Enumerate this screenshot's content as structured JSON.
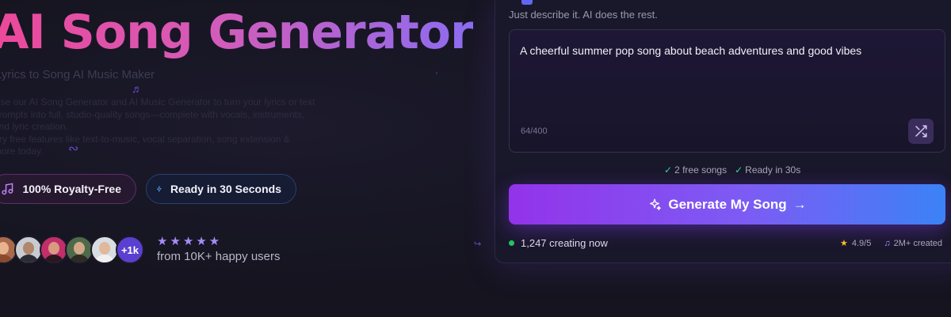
{
  "hero": {
    "title": "AI Song Generator",
    "subtitle": "Lyrics to Song AI Music Maker",
    "description_lines": [
      "Use our AI Song Generator and AI Music Generator to turn your lyrics or text",
      "prompts into full, studio-quality songs—complete with vocals, instruments,",
      "and lyric creation.",
      "Try free features like text-to-music, vocal separation, song extension &",
      "more today."
    ],
    "badges": {
      "royalty_free": "100% Royalty-Free",
      "ready_time": "Ready in 30 Seconds"
    },
    "social": {
      "more_count": "+1k",
      "stars": "★★★★★",
      "happy_users": "from 10K+ happy users"
    }
  },
  "generator": {
    "hint": "Just describe it. AI does the rest.",
    "prompt_value": "A cheerful summer pop song about beach adventures and good vibes",
    "char_count": "64/400",
    "perks": [
      "2 free songs",
      "Ready in 30s"
    ],
    "generate_label": "Generate My Song",
    "live_count": "1,247 creating now",
    "rating": "4.9/5",
    "created": "2M+ created"
  },
  "colors": {
    "title_gradient_start": "#ec4899",
    "title_gradient_end": "#8b6cf0",
    "button_gradient_start": "#9333ea",
    "button_gradient_end": "#3b82f6",
    "live_dot": "#22c55e",
    "check": "#34d399",
    "rating_star": "#fbbf24"
  },
  "icons": [
    "music-note-icon",
    "lightning-icon",
    "shuffle-icon",
    "sparkle-icon",
    "arrow-right-icon",
    "check-icon",
    "star-icon"
  ]
}
